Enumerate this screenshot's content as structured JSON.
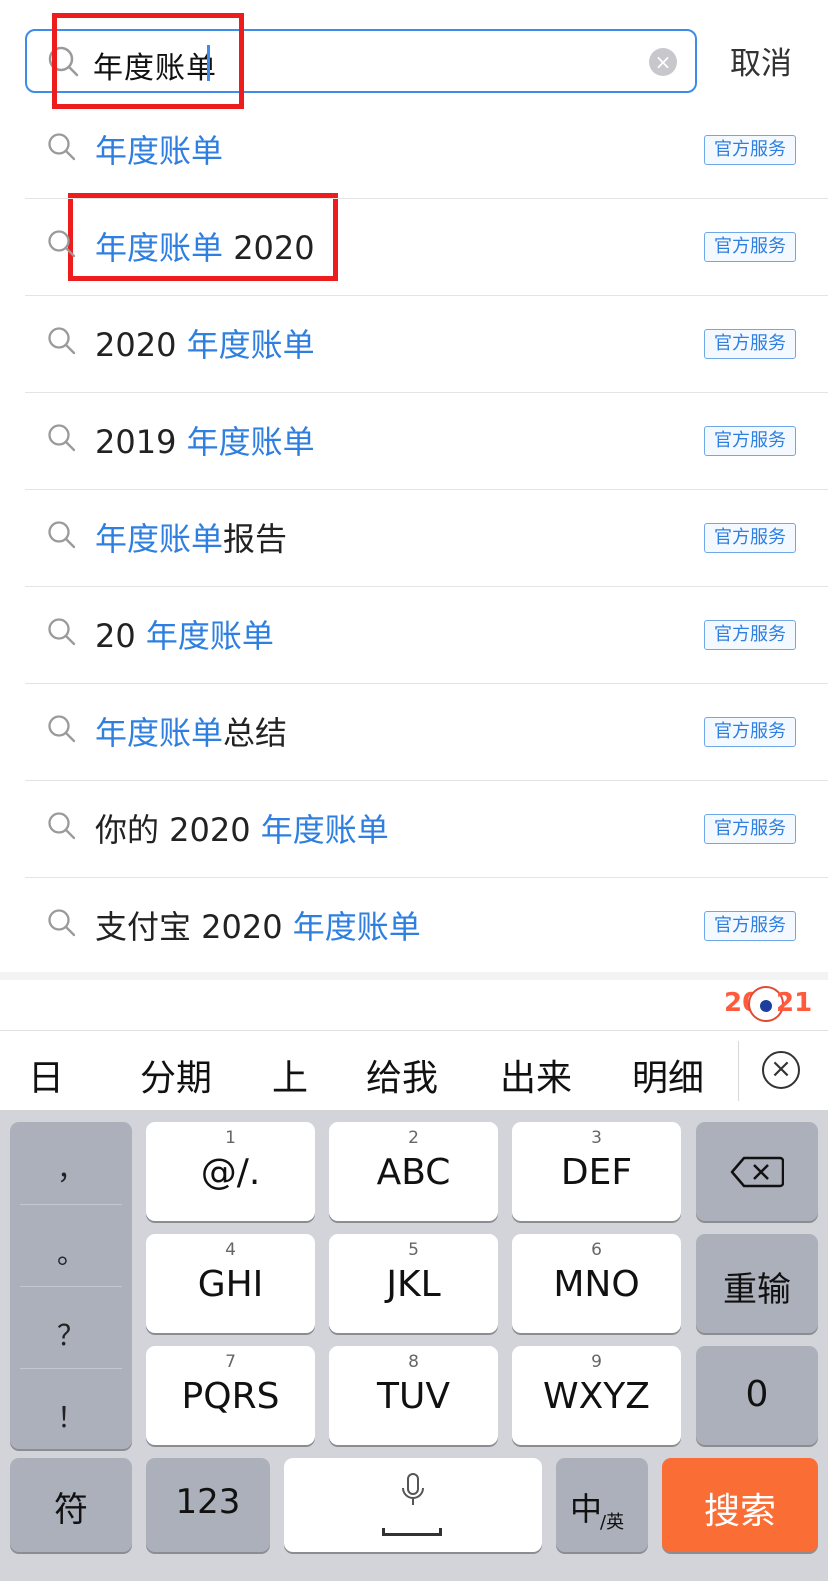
{
  "search": {
    "query": "年度账单",
    "cancel_label": "取消"
  },
  "suggestions": [
    {
      "parts": [
        {
          "text": "年度账单",
          "hl": true
        }
      ],
      "tag": "官方服务"
    },
    {
      "parts": [
        {
          "text": "年度账单",
          "hl": true
        },
        {
          "text": " 2020",
          "hl": false
        }
      ],
      "tag": "官方服务"
    },
    {
      "parts": [
        {
          "text": "2020 ",
          "hl": false
        },
        {
          "text": "年度账单",
          "hl": true
        }
      ],
      "tag": "官方服务"
    },
    {
      "parts": [
        {
          "text": "2019 ",
          "hl": false
        },
        {
          "text": "年度账单",
          "hl": true
        }
      ],
      "tag": "官方服务"
    },
    {
      "parts": [
        {
          "text": "年度账单",
          "hl": true
        },
        {
          "text": "报告",
          "hl": false
        }
      ],
      "tag": "官方服务"
    },
    {
      "parts": [
        {
          "text": "20 ",
          "hl": false
        },
        {
          "text": "年度账单",
          "hl": true
        }
      ],
      "tag": "官方服务"
    },
    {
      "parts": [
        {
          "text": "年度账单",
          "hl": true
        },
        {
          "text": "总结",
          "hl": false
        }
      ],
      "tag": "官方服务"
    },
    {
      "parts": [
        {
          "text": "你的 2020 ",
          "hl": false
        },
        {
          "text": "年度账单",
          "hl": true
        }
      ],
      "tag": "官方服务"
    },
    {
      "parts": [
        {
          "text": "支付宝 2020 ",
          "hl": false
        },
        {
          "text": "年度账单",
          "hl": true
        }
      ],
      "tag": "官方服务"
    }
  ],
  "badge": {
    "left": "20",
    "right": "21"
  },
  "candidates": [
    "日",
    "分期",
    "上",
    "给我",
    "出来",
    "明细"
  ],
  "keyboard": {
    "punctuation": [
      "，",
      "。",
      "？",
      "！"
    ],
    "keys": [
      {
        "num": "1",
        "label": "@/."
      },
      {
        "num": "2",
        "label": "ABC"
      },
      {
        "num": "3",
        "label": "DEF"
      },
      {
        "num": "4",
        "label": "GHI"
      },
      {
        "num": "5",
        "label": "JKL"
      },
      {
        "num": "6",
        "label": "MNO"
      },
      {
        "num": "7",
        "label": "PQRS"
      },
      {
        "num": "8",
        "label": "TUV"
      },
      {
        "num": "9",
        "label": "WXYZ"
      }
    ],
    "reinput_label": "重输",
    "zero_label": "0",
    "symbol_label": "符",
    "numeric_label": "123",
    "lang_main": "中",
    "lang_sub": "/英",
    "search_label": "搜索"
  },
  "colors": {
    "accent": "#2e7fe0",
    "annotation": "#ee1d1d",
    "search_key": "#fa6d35"
  }
}
